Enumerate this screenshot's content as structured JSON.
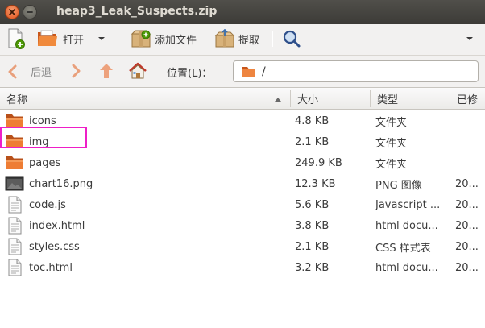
{
  "window": {
    "title": "heap3_Leak_Suspects.zip"
  },
  "toolbar": {
    "open_label": "打开",
    "add_files_label": "添加文件",
    "extract_label": "提取"
  },
  "location": {
    "back_label": "后退",
    "label": "位置(L)：",
    "path": "/"
  },
  "columns": {
    "name": "名称",
    "size": "大小",
    "type": "类型",
    "modified": "已修"
  },
  "files": [
    {
      "name": "icons",
      "size": "4.8 KB",
      "type": "文件夹",
      "modified": "",
      "icon": "folder-icon"
    },
    {
      "name": "img",
      "size": "2.1 KB",
      "type": "文件夹",
      "modified": "",
      "icon": "folder-icon"
    },
    {
      "name": "pages",
      "size": "249.9 KB",
      "type": "文件夹",
      "modified": "",
      "icon": "folder-icon"
    },
    {
      "name": "chart16.png",
      "size": "12.3 KB",
      "type": "PNG 图像",
      "modified": "20...",
      "icon": "image-file-icon"
    },
    {
      "name": "code.js",
      "size": "5.6 KB",
      "type": "Javascript ...",
      "modified": "20...",
      "icon": "text-file-icon"
    },
    {
      "name": "index.html",
      "size": "3.8 KB",
      "type": "html docu...",
      "modified": "20...",
      "icon": "text-file-icon"
    },
    {
      "name": "styles.css",
      "size": "2.1 KB",
      "type": "CSS 样式表",
      "modified": "20...",
      "icon": "text-file-icon"
    },
    {
      "name": "toc.html",
      "size": "3.2 KB",
      "type": "html docu...",
      "modified": "20...",
      "icon": "text-file-icon"
    }
  ],
  "colors": {
    "highlight": "#ee1fc7",
    "folder": "#e5742b",
    "titlebar": "#3c3b37"
  }
}
